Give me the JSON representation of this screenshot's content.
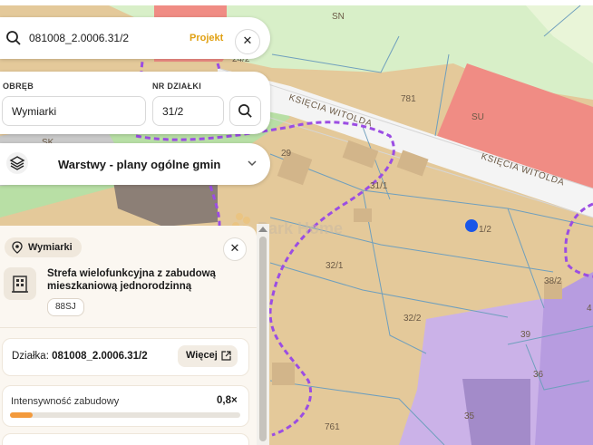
{
  "search": {
    "query": "081008_2.0006.31/2",
    "tag": "Projekt",
    "icon": "search-icon",
    "close_icon": "close-icon"
  },
  "plot_search": {
    "precinct_label": "OBRĘB",
    "precinct_value": "Wymiarki",
    "plot_label": "NR DZIAŁKI",
    "plot_value": "31/2"
  },
  "layers": {
    "label": "Warstwy - plany ogólne gmin",
    "icon": "layers-icon"
  },
  "map": {
    "watermark": "Park Home",
    "zones": [
      {
        "label": "SN",
        "color": "#d8efc8"
      },
      {
        "label": "SU",
        "color": "#f08c84"
      },
      {
        "label": "SK",
        "color": "#c9c9c9"
      },
      {
        "label": "",
        "color": "#cbb2e8"
      }
    ],
    "roads": [
      "KSIĘCIA WITOLDA",
      "KSIĘCIA WITOLDA"
    ],
    "parcels": [
      "29",
      "31/1",
      "781",
      "32/1",
      "32/2",
      "38/2",
      "39",
      "36",
      "35",
      "761",
      "24/2",
      "1/2",
      "4"
    ],
    "colors": {
      "residential": "#e4c99a",
      "boundary": "#9b4de3",
      "marker": "#1a56e8",
      "parcel_line": "#6f9fbd"
    }
  },
  "info": {
    "location": "Wymiarki",
    "zone_name": "Strefa wielofunkcyjna z zabudową mieszkaniową jednorodzinną",
    "zone_code": "88SJ",
    "plot_label": "Działka:",
    "plot_id": "081008_2.0006.31/2",
    "more_label": "Więcej",
    "intensity_label": "Intensywność zabudowy",
    "intensity_value": "0,8×",
    "intensity_fraction": 0.1
  }
}
